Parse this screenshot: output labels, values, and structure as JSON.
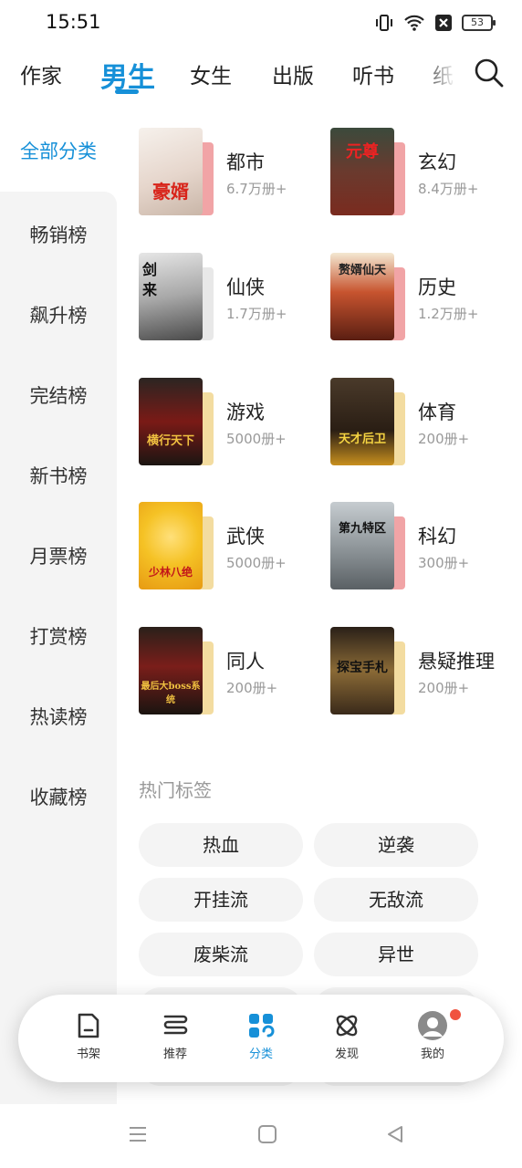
{
  "status": {
    "time": "15:51",
    "battery": "53"
  },
  "top_tabs": [
    {
      "label": "作家",
      "active": false
    },
    {
      "label": "男生",
      "active": true
    },
    {
      "label": "女生",
      "active": false
    },
    {
      "label": "出版",
      "active": false
    },
    {
      "label": "听书",
      "active": false
    },
    {
      "label": "纸",
      "active": false
    }
  ],
  "sidebar": {
    "all_label": "全部分类",
    "items": [
      "畅销榜",
      "飙升榜",
      "完结榜",
      "新书榜",
      "月票榜",
      "打赏榜",
      "热读榜",
      "收藏榜"
    ]
  },
  "categories": [
    {
      "name": "都市",
      "count": "6.7万册+",
      "cover_title": "豪婿",
      "accent": "#f1a4a6"
    },
    {
      "name": "玄幻",
      "count": "8.4万册+",
      "cover_title": "元尊",
      "accent": "#f1a4a6"
    },
    {
      "name": "仙侠",
      "count": "1.7万册+",
      "cover_title": "剑来",
      "accent": "#e8e8e8"
    },
    {
      "name": "历史",
      "count": "1.2万册+",
      "cover_title": "赘婿仙天",
      "accent": "#f1a4a6"
    },
    {
      "name": "游戏",
      "count": "5000册+",
      "cover_title": "横行天下",
      "accent": "#f3dca0"
    },
    {
      "name": "体育",
      "count": "200册+",
      "cover_title": "天才后卫",
      "accent": "#f3dca0"
    },
    {
      "name": "武侠",
      "count": "5000册+",
      "cover_title": "少林八绝",
      "accent": "#f3dca0"
    },
    {
      "name": "科幻",
      "count": "300册+",
      "cover_title": "第九特区",
      "accent": "#f1a4a6"
    },
    {
      "name": "同人",
      "count": "200册+",
      "cover_title": "最后大boss系统",
      "accent": "#f3dca0"
    },
    {
      "name": "悬疑推理",
      "count": "200册+",
      "cover_title": "探宝手札",
      "accent": "#f3dca0"
    }
  ],
  "hot_tags": {
    "title": "热门标签",
    "tags": [
      "热血",
      "逆袭",
      "开挂流",
      "无敌流",
      "废柴流",
      "异世"
    ]
  },
  "bottom_nav": [
    {
      "label": "书架",
      "icon": "bookshelf-icon"
    },
    {
      "label": "推荐",
      "icon": "recommend-icon"
    },
    {
      "label": "分类",
      "icon": "category-icon"
    },
    {
      "label": "发现",
      "icon": "discover-icon"
    },
    {
      "label": "我的",
      "icon": "avatar-icon"
    }
  ],
  "colors": {
    "accent": "#1690d8",
    "badge": "#f0533f"
  }
}
